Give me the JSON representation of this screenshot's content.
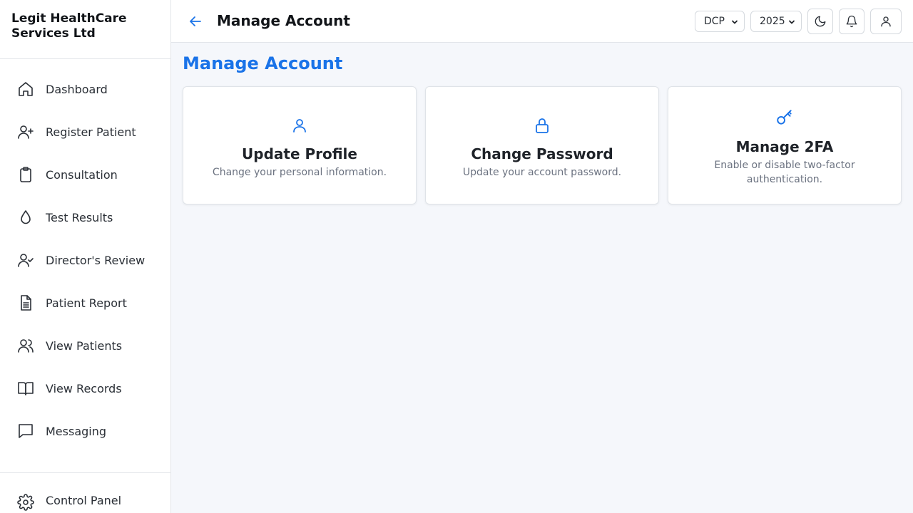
{
  "sidebar": {
    "brand": "Legit HealthCare Services Ltd",
    "items": [
      {
        "label": "Dashboard",
        "icon": "home-icon"
      },
      {
        "label": "Register Patient",
        "icon": "user-plus-icon"
      },
      {
        "label": "Consultation",
        "icon": "clipboard-icon"
      },
      {
        "label": "Test Results",
        "icon": "droplet-icon"
      },
      {
        "label": "Director's Review",
        "icon": "user-check-icon"
      },
      {
        "label": "Patient Report",
        "icon": "document-icon"
      },
      {
        "label": "View Patients",
        "icon": "users-icon"
      },
      {
        "label": "View Records",
        "icon": "book-icon"
      },
      {
        "label": "Messaging",
        "icon": "message-icon"
      }
    ],
    "bottom": {
      "label": "Control Panel",
      "icon": "gear-icon"
    }
  },
  "header": {
    "title": "Manage Account",
    "unit_select": "DCP",
    "year_select": "2025"
  },
  "main": {
    "heading": "Manage Account",
    "cards": [
      {
        "title": "Update Profile",
        "description": "Change your personal information.",
        "icon": "user-icon"
      },
      {
        "title": "Change Password",
        "description": "Update your account password.",
        "icon": "lock-icon"
      },
      {
        "title": "Manage 2FA",
        "description": "Enable or disable two-factor authentication.",
        "icon": "key-icon"
      }
    ]
  },
  "colors": {
    "accent": "#1a73e8",
    "background": "#f5f7fb",
    "border": "#e3e6ea"
  }
}
